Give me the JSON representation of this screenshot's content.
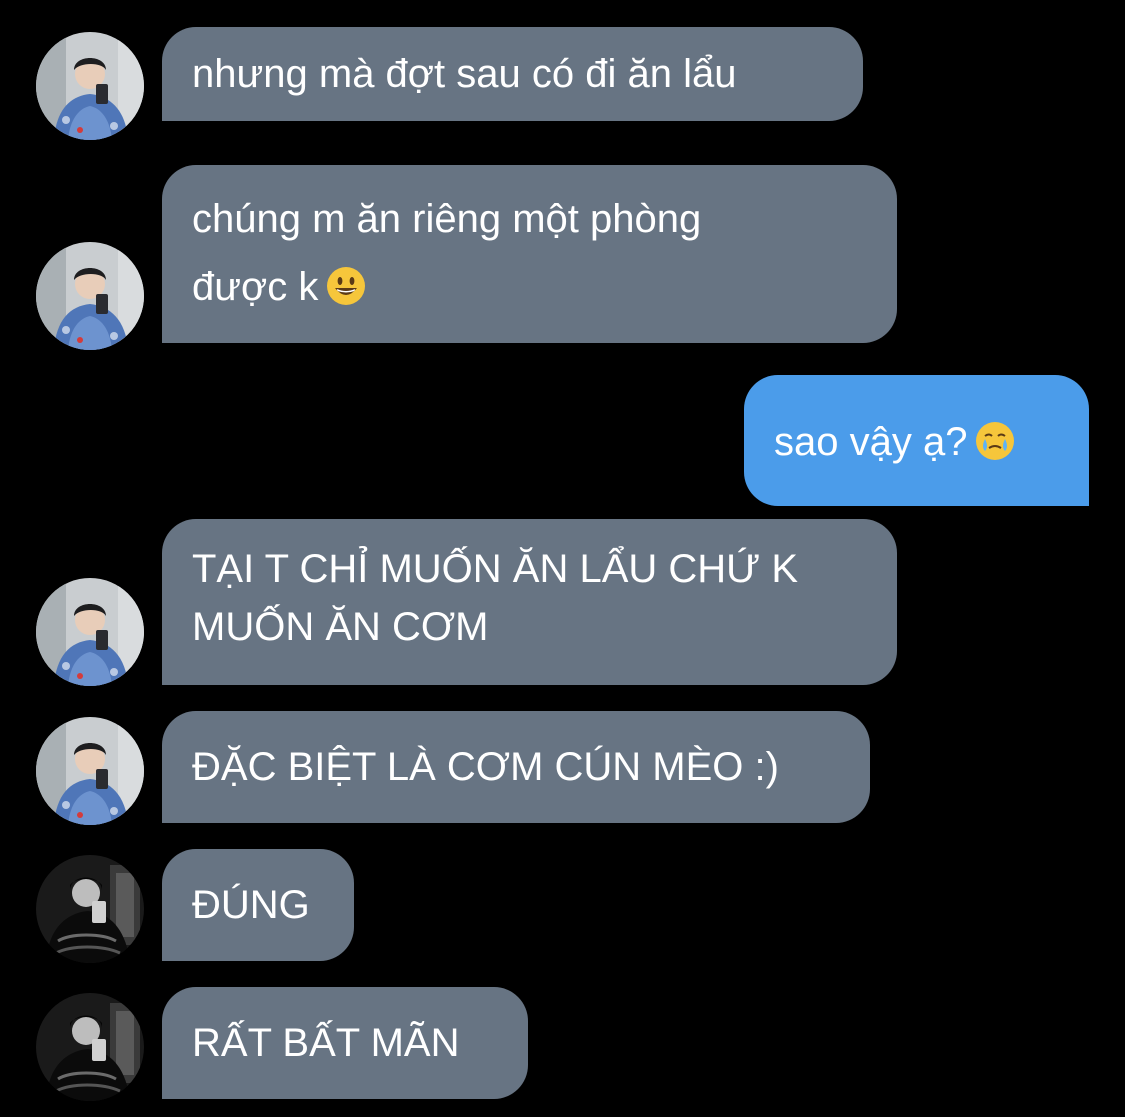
{
  "messages": [
    {
      "side": "incoming",
      "avatar": "avatar-user-a",
      "lines": [
        "nhưng mà đợt sau có đi ăn lẩu"
      ]
    },
    {
      "side": "incoming",
      "avatar": "avatar-user-a",
      "lines": [
        "chúng m ăn riêng một phòng",
        "được k"
      ],
      "emoji": "grinning-face-icon"
    },
    {
      "side": "outgoing",
      "lines": [
        "sao vậy ạ?"
      ],
      "emoji": "face-holding-back-tears-icon"
    },
    {
      "side": "incoming",
      "avatar": "avatar-user-a",
      "lines": [
        "TẠI T CHỈ MUỐN ĂN LẨU CHỨ K",
        "MUỐN ĂN CƠM"
      ]
    },
    {
      "side": "incoming",
      "avatar": "avatar-user-a",
      "lines": [
        "ĐẶC BIỆT LÀ CƠM CÚN MÈO :)"
      ]
    },
    {
      "side": "incoming",
      "avatar": "avatar-user-b",
      "lines": [
        "ĐÚNG"
      ]
    },
    {
      "side": "incoming",
      "avatar": "avatar-user-b",
      "lines": [
        "RẤT BẤT MÃN"
      ]
    }
  ],
  "colors": {
    "background": "#000000",
    "incoming_bubble": "#677483",
    "outgoing_bubble": "#4b9cea",
    "text": "#ffffff"
  }
}
